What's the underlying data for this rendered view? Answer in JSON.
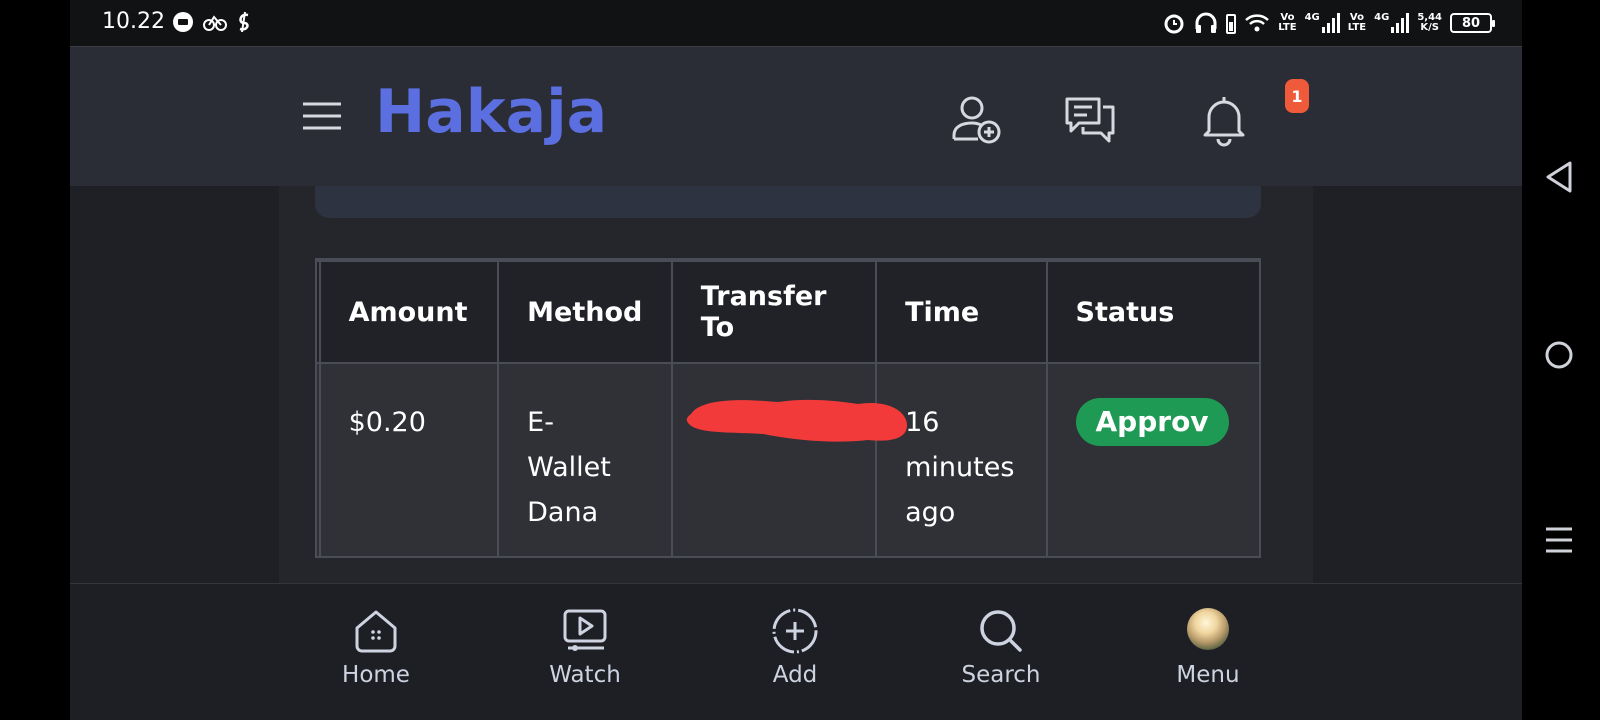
{
  "status_bar": {
    "time": "10.22",
    "net_label_1": "Vo",
    "net_sub_1": "LTE",
    "net_gen_1": "4G",
    "net_label_2": "Vo",
    "net_sub_2": "LTE",
    "net_gen_2": "4G",
    "speed": "5,44",
    "speed_unit": "K/S",
    "battery": "80"
  },
  "header": {
    "brand": "Hakaja",
    "notification_count": "1"
  },
  "table": {
    "columns": [
      "Amount",
      "Method",
      "Transfer To",
      "Time",
      "Status"
    ],
    "rows": [
      {
        "amount": "$0.20",
        "method_lines": [
          "E-",
          "Wallet",
          "Dana"
        ],
        "time_lines": [
          "16",
          "minutes",
          "ago"
        ],
        "status": "Approv"
      }
    ]
  },
  "bottom_nav": {
    "items": [
      {
        "label": "Home",
        "icon": "home-icon"
      },
      {
        "label": "Watch",
        "icon": "watch-icon"
      },
      {
        "label": "Add",
        "icon": "add-icon"
      },
      {
        "label": "Search",
        "icon": "search-icon"
      },
      {
        "label": "Menu",
        "icon": "avatar"
      }
    ]
  },
  "colors": {
    "brand": "#5b6fe0",
    "badge": "#ef5a3a",
    "approved": "#1e9a55",
    "redaction": "#f23a3a"
  }
}
